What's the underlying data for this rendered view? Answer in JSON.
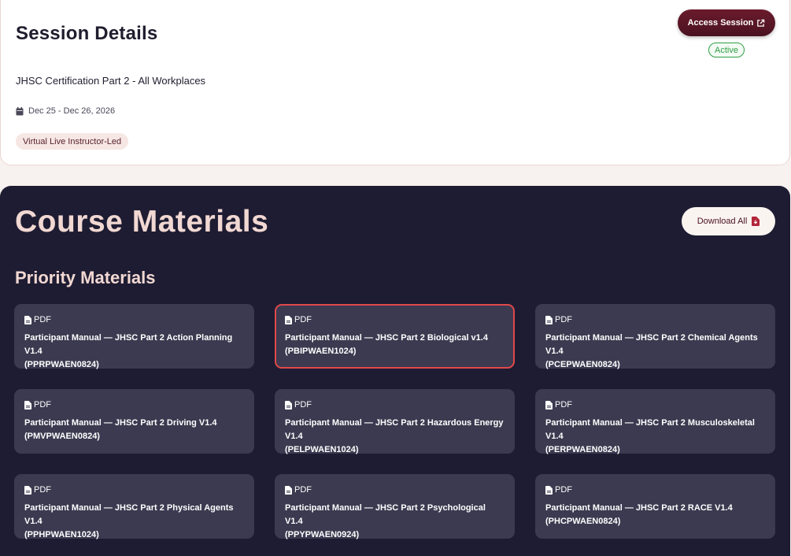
{
  "session": {
    "title": "Session Details",
    "access_label": "Access Session",
    "status": "Active",
    "course_name": "JHSC Certification Part 2 - All Workplaces",
    "dates": "Dec 25 - Dec 26, 2026",
    "format": "Virtual Live Instructor-Led"
  },
  "materials": {
    "title": "Course Materials",
    "download_all_label": "Download All",
    "priority_title": "Priority Materials",
    "items": [
      {
        "type": "PDF",
        "title": "Participant Manual — JHSC Part 2 Action Planning V1.4",
        "code": "(PPRPWAEN0824)"
      },
      {
        "type": "PDF",
        "title": "Participant Manual — JHSC Part 2 Biological v1.4",
        "code": "(PBIPWAEN1024)"
      },
      {
        "type": "PDF",
        "title": "Participant Manual — JHSC Part 2 Chemical Agents V1.4",
        "code": "(PCEPWAEN0824)"
      },
      {
        "type": "PDF",
        "title": "Participant Manual — JHSC Part 2 Driving V1.4",
        "code": "(PMVPWAEN0824)"
      },
      {
        "type": "PDF",
        "title": "Participant Manual — JHSC Part 2 Hazardous Energy V1.4",
        "code": "(PELPWAEN1024)"
      },
      {
        "type": "PDF",
        "title": "Participant Manual — JHSC Part 2 Musculoskeletal V1.4",
        "code": "(PERPWAEN0824)"
      },
      {
        "type": "PDF",
        "title": "Participant Manual — JHSC Part 2 Physical Agents V1.4",
        "code": "(PPHPWAEN1024)"
      },
      {
        "type": "PDF",
        "title": "Participant Manual — JHSC Part 2 Psychological V1.4",
        "code": "(PPYPWAEN0924)"
      },
      {
        "type": "PDF",
        "title": "Participant Manual — JHSC Part 2 RACE V1.4",
        "code": "(PHCPWAEN0824)"
      }
    ]
  },
  "colors": {
    "primary": "#4a1220",
    "dark_panel": "#1e1c32",
    "card": "#3c3a50",
    "active": "#2f9e44",
    "selected_border": "#e0484a"
  },
  "icons": [
    "external-link-icon",
    "calendar-icon",
    "pdf-file-icon"
  ]
}
